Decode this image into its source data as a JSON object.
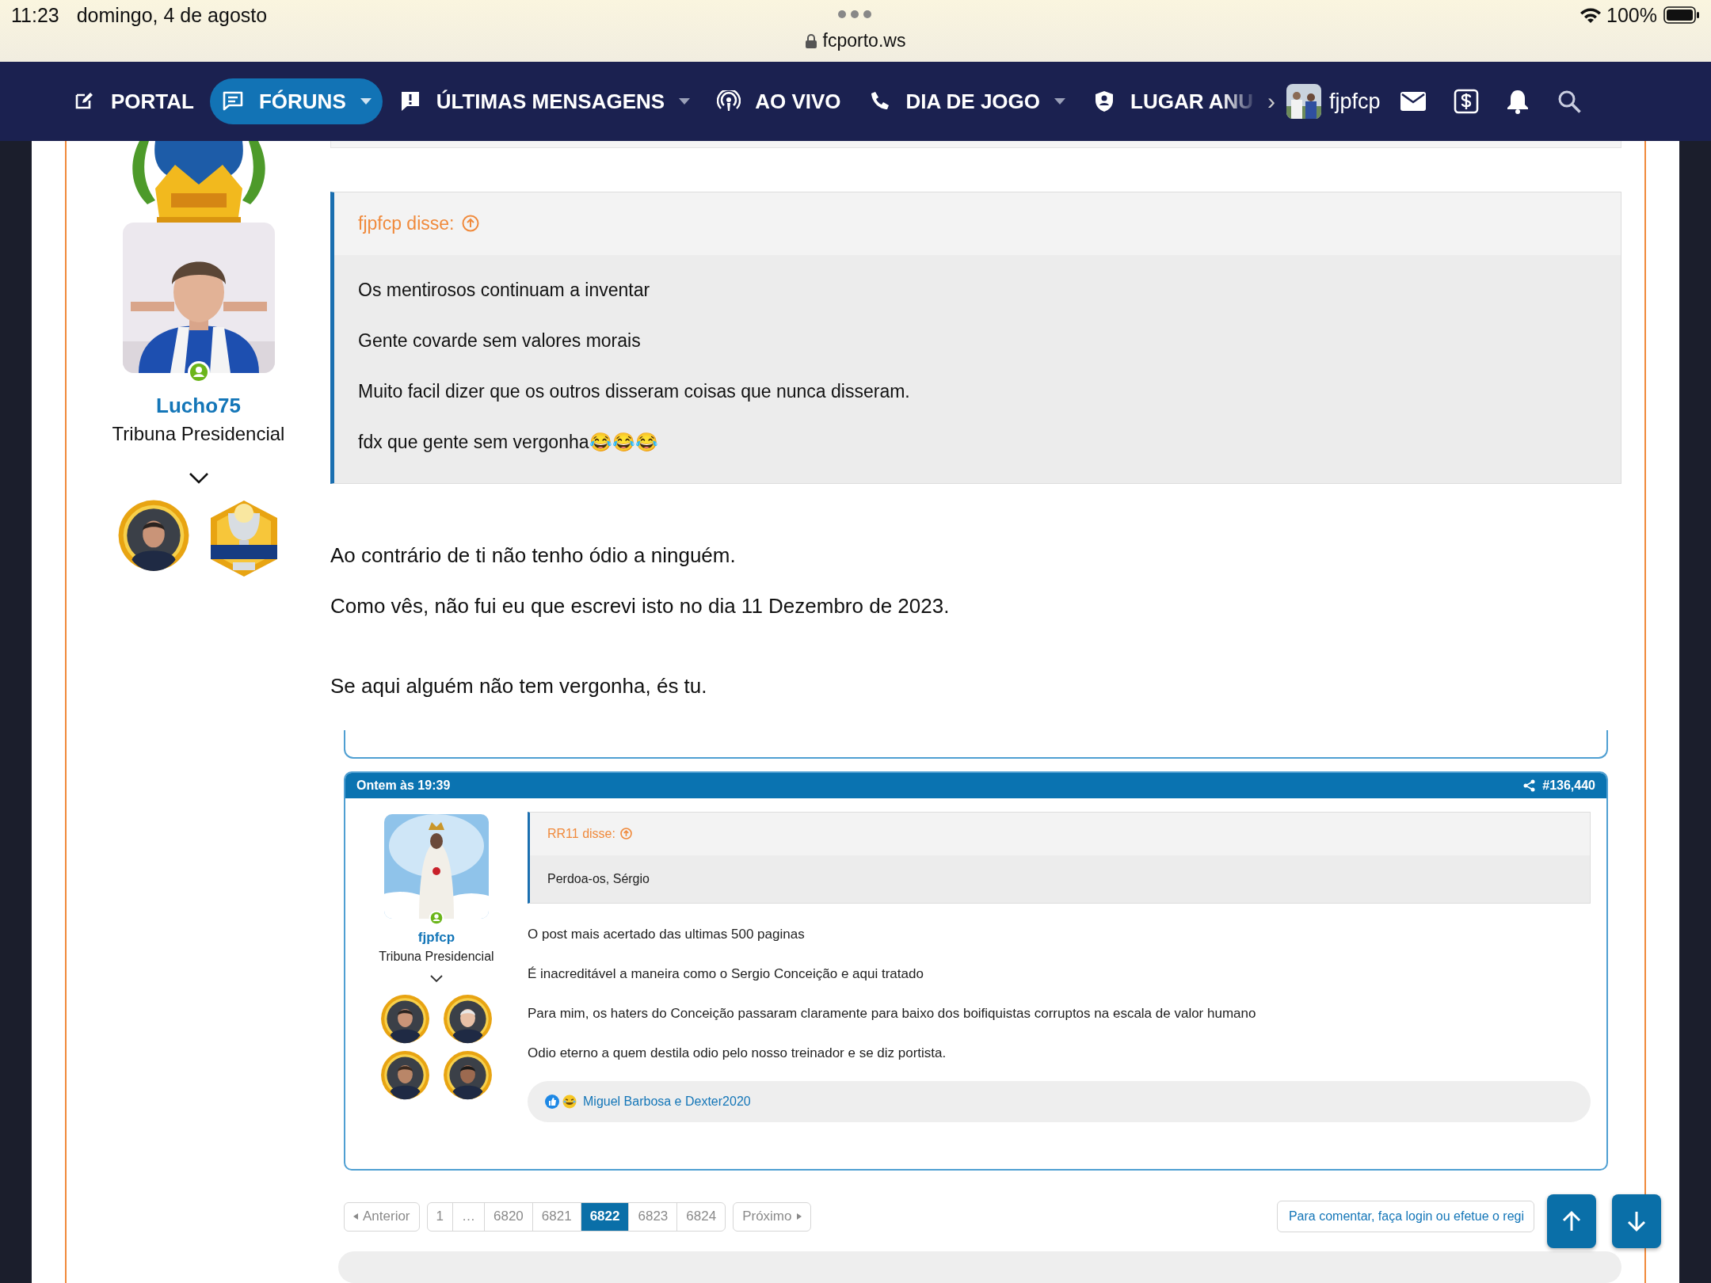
{
  "status_bar": {
    "time": "11:23",
    "date": "domingo, 4 de agosto",
    "battery": "100%"
  },
  "address_bar": {
    "url": "fcporto.ws"
  },
  "nav": {
    "items": [
      {
        "label": "PORTAL",
        "dropdown": false,
        "selected": false
      },
      {
        "label": "FÓRUNS",
        "dropdown": true,
        "selected": true
      },
      {
        "label": "ÚLTIMAS MENSAGENS",
        "dropdown": true,
        "selected": false
      },
      {
        "label": "AO VIVO",
        "dropdown": false,
        "selected": false
      },
      {
        "label": "DIA DE JOGO",
        "dropdown": true,
        "selected": false
      },
      {
        "label": "LUGAR ANU",
        "dropdown": false,
        "selected": false
      }
    ],
    "more": "›",
    "user": "fjpfcp"
  },
  "post": {
    "author": {
      "name": "Lucho75",
      "rank": "Tribuna Presidencial",
      "online": true
    },
    "quote": {
      "header": "fjpfcp disse:",
      "lines": [
        "Os mentirosos continuam a inventar",
        "Gente covarde sem valores morais",
        "Muito facil dizer que os outros disseram coisas que nunca disseram.",
        "fdx que gente sem vergonha😂😂😂"
      ]
    },
    "paragraphs": [
      "Ao contrário de ti não tenho ódio a ninguém.",
      "Como vês, não fui eu que escrevi isto no dia 11 Dezembro de 2023.",
      "Se aqui alguém não tem vergonha, és tu."
    ],
    "embedded": {
      "date": "Ontem às 19:39",
      "number": "#136,440",
      "author": {
        "name": "fjpfcp",
        "rank": "Tribuna Presidencial",
        "online": true
      },
      "quote": {
        "header": "RR11 disse:",
        "lines": [
          "Perdoa-os, Sérgio"
        ]
      },
      "lines": [
        "O post mais acertado das ultimas 500 paginas",
        "É inacreditável a maneira como o Sergio Conceição e aqui tratado",
        "Para mim, os haters do Conceição passaram claramente para baixo dos boifiquistas corruptos na escala de valor humano",
        "Odio eterno a quem destila odio pelo nosso treinador e se diz portista."
      ],
      "reactions": "Miguel Barbosa e Dexter2020"
    }
  },
  "pagination": {
    "previous": "Anterior",
    "pages": [
      {
        "label": "1",
        "selected": false
      },
      {
        "label": "…",
        "selected": false
      },
      {
        "label": "6820",
        "selected": false
      },
      {
        "label": "6821",
        "selected": false
      },
      {
        "label": "6822",
        "selected": true
      },
      {
        "label": "6823",
        "selected": false
      },
      {
        "label": "6824",
        "selected": false
      }
    ],
    "next": "Próximo"
  },
  "comment_button": "Para comentar, faça login ou efetue o regi"
}
